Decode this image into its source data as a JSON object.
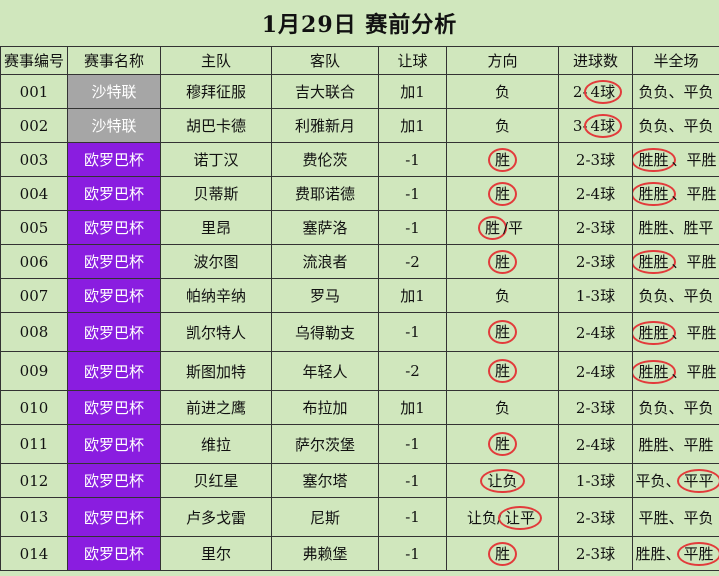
{
  "title": "1月29日  赛前分析",
  "headers": [
    "赛事编号",
    "赛事名称",
    "主队",
    "客队",
    "让球",
    "方向",
    "进球数",
    "半全场"
  ],
  "colors": {
    "background": "#d0e7bd",
    "league_gray": "#a6a6a6",
    "league_purple": "#8a1de0",
    "circle": "#e23b3b"
  },
  "rows": [
    {
      "id": "001",
      "league": "沙特联",
      "home": "穆拜征服",
      "away": "吉大联合",
      "handicap": "加1",
      "direction": "负",
      "goals": "2-4球",
      "ht_ft": "负负、平负"
    },
    {
      "id": "002",
      "league": "沙特联",
      "home": "胡巴卡德",
      "away": "利雅新月",
      "handicap": "加1",
      "direction": "负",
      "goals": "3-4球",
      "ht_ft": "负负、平负"
    },
    {
      "id": "003",
      "league": "欧罗巴杯",
      "home": "诺丁汉",
      "away": "费伦茨",
      "handicap": "-1",
      "direction": "胜",
      "goals": "2-3球",
      "ht_ft": "胜胜、平胜"
    },
    {
      "id": "004",
      "league": "欧罗巴杯",
      "home": "贝蒂斯",
      "away": "费耶诺德",
      "handicap": "-1",
      "direction": "胜",
      "goals": "2-4球",
      "ht_ft": "胜胜、平胜"
    },
    {
      "id": "005",
      "league": "欧罗巴杯",
      "home": "里昂",
      "away": "塞萨洛",
      "handicap": "-1",
      "direction": "胜/平",
      "goals": "2-3球",
      "ht_ft": "胜胜、胜平"
    },
    {
      "id": "006",
      "league": "欧罗巴杯",
      "home": "波尔图",
      "away": "流浪者",
      "handicap": "-2",
      "direction": "胜",
      "goals": "2-3球",
      "ht_ft": "胜胜、平胜"
    },
    {
      "id": "007",
      "league": "欧罗巴杯",
      "home": "帕纳辛纳",
      "away": "罗马",
      "handicap": "加1",
      "direction": "负",
      "goals": "1-3球",
      "ht_ft": "负负、平负"
    },
    {
      "id": "008",
      "league": "欧罗巴杯",
      "home": "凯尔特人",
      "away": "乌得勒支",
      "handicap": "-1",
      "direction": "胜",
      "goals": "2-4球",
      "ht_ft": "胜胜、平胜"
    },
    {
      "id": "009",
      "league": "欧罗巴杯",
      "home": "斯图加特",
      "away": "年轻人",
      "handicap": "-2",
      "direction": "胜",
      "goals": "2-4球",
      "ht_ft": "胜胜、平胜"
    },
    {
      "id": "010",
      "league": "欧罗巴杯",
      "home": "前进之鹰",
      "away": "布拉加",
      "handicap": "加1",
      "direction": "负",
      "goals": "2-3球",
      "ht_ft": "负负、平负"
    },
    {
      "id": "011",
      "league": "欧罗巴杯",
      "home": "维拉",
      "away": "萨尔茨堡",
      "handicap": "-1",
      "direction": "胜",
      "goals": "2-4球",
      "ht_ft": "胜胜、平胜"
    },
    {
      "id": "012",
      "league": "欧罗巴杯",
      "home": "贝红星",
      "away": "塞尔塔",
      "handicap": "-1",
      "direction": "让负",
      "goals": "1-3球",
      "ht_ft": "平负、平平"
    },
    {
      "id": "013",
      "league": "欧罗巴杯",
      "home": "卢多戈雷",
      "away": "尼斯",
      "handicap": "-1",
      "direction": "让负/让平",
      "goals": "2-3球",
      "ht_ft": "平胜、平负"
    },
    {
      "id": "014",
      "league": "欧罗巴杯",
      "home": "里尔",
      "away": "弗赖堡",
      "handicap": "-1",
      "direction": "胜",
      "goals": "2-3球",
      "ht_ft": "胜胜、平胜"
    }
  ]
}
